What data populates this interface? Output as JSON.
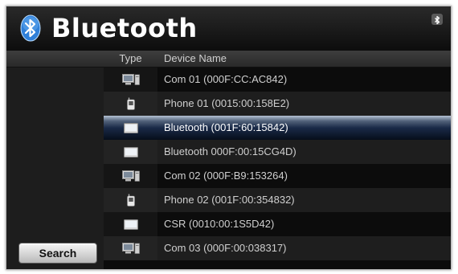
{
  "app": {
    "title": "Bluetooth",
    "logo_icon": "bluetooth-logo-icon",
    "status_icon": "bluetooth-status-icon"
  },
  "table": {
    "headers": {
      "type": "Type",
      "name": "Device Name"
    },
    "rows": [
      {
        "icon": "computer-icon",
        "name": "Com 01 (000F:CC:AC842)",
        "selected": false
      },
      {
        "icon": "phone-icon",
        "name": "Phone 01 (0015:00:158E2)",
        "selected": false
      },
      {
        "icon": "monitor-icon",
        "name": "Bluetooth (001F:60:15842)",
        "selected": true
      },
      {
        "icon": "monitor-icon",
        "name": "Bluetooth 000F:00:15CG4D)",
        "selected": false
      },
      {
        "icon": "computer-icon",
        "name": "Com 02 (000F:B9:153264)",
        "selected": false
      },
      {
        "icon": "phone-icon",
        "name": "Phone 02 (001F:00:354832)",
        "selected": false
      },
      {
        "icon": "monitor-icon",
        "name": "CSR (0010:00:1S5D42)",
        "selected": false
      },
      {
        "icon": "computer-icon",
        "name": "Com 03 (000F:00:038317)",
        "selected": false
      }
    ]
  },
  "sidebar": {
    "search_label": "Search"
  },
  "colors": {
    "background": "#0c0c0c",
    "selection": "#1a2a48",
    "text": "#cfcfcf"
  }
}
